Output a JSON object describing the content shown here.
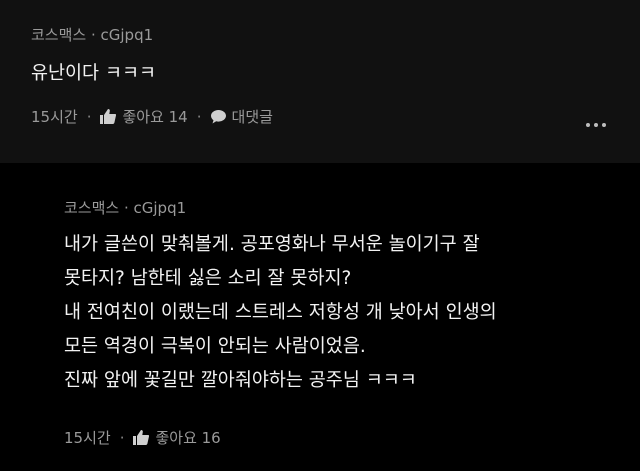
{
  "comments": [
    {
      "author": "코스맥스 · cGjpq1",
      "lines": [
        "유난이다 ㅋㅋㅋ"
      ],
      "time": "15시간",
      "like_label": "좋아요 14",
      "reply_label": "대댓글",
      "icons": [
        "thumbs-up-icon",
        "speech-bubble-icon",
        "more-icon"
      ]
    },
    {
      "author": "코스맥스 · cGjpq1",
      "lines": [
        "내가 글쓴이 맞춰볼게. 공포영화나 무서운 놀이기구 잘",
        "못타지? 남한테 싫은 소리 잘 못하지?",
        "내 전여친이 이랬는데 스트레스 저항성 개 낮아서 인생의",
        "모든 역경이 극복이 안되는 사람이었음.",
        "진짜 앞에 꽃길만 깔아줘야하는 공주님 ㅋㅋㅋ"
      ],
      "time": "15시간",
      "like_label": "좋아요 16",
      "icons": [
        "thumbs-up-icon"
      ]
    }
  ],
  "separator": "·"
}
